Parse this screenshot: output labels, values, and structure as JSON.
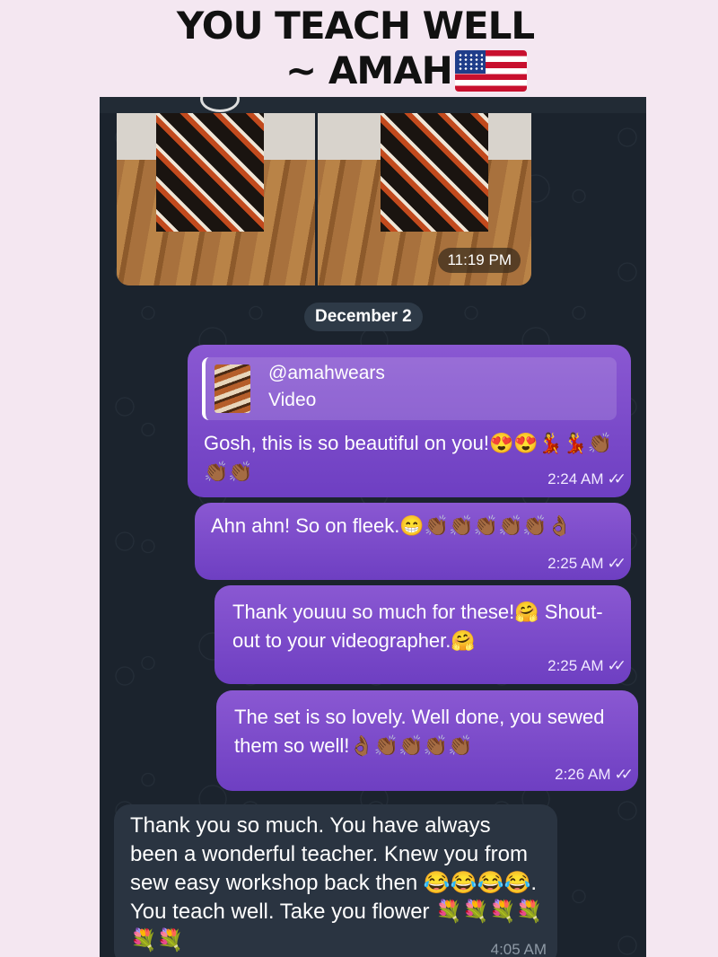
{
  "header": {
    "line1": "YOU TEACH WELL",
    "line2": "~ AMAH",
    "flag_icon": "us-flag-icon"
  },
  "chat": {
    "media": {
      "time": "11:19 PM"
    },
    "date_separator": "December 2",
    "messages": [
      {
        "reply_to": {
          "username": "@amahwears",
          "kind": "Video"
        },
        "text": "Gosh, this is so beautiful on you!😍😍💃💃👏🏾👏🏾👏🏾",
        "time": "2:24 AM",
        "status": "read"
      },
      {
        "text": "Ahn ahn! So on fleek.😁👏🏾👏🏾👏🏾👏🏾👏🏾👌🏾",
        "time": "2:25 AM",
        "status": "read"
      },
      {
        "text": "Thank youuu so much for these!🤗 Shout-out to your videographer.🤗",
        "time": "2:25 AM",
        "status": "read"
      },
      {
        "text": "The set is so lovely. Well done, you sewed them so well!👌🏾👏🏾👏🏾👏🏾👏🏾",
        "time": "2:26 AM",
        "status": "read"
      },
      {
        "text": "Thank you so much. You have always been a wonderful teacher. Knew you from sew easy workshop back then 😂😂😂😂. You teach well. Take you flower 💐💐💐💐💐💐",
        "time": "4:05 AM",
        "status": "incoming"
      }
    ],
    "ticks_glyph": "✓✓"
  }
}
